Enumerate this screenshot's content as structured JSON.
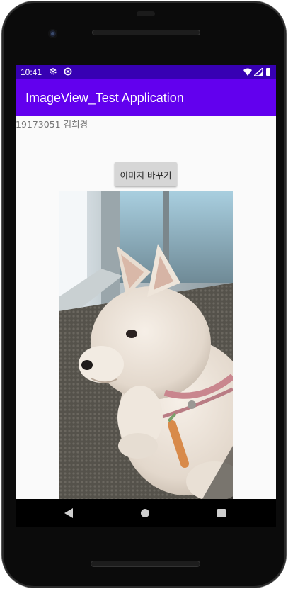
{
  "status_bar": {
    "time": "10:41",
    "icons": [
      "gear-icon",
      "sync-icon",
      "wifi-icon",
      "signal-icon",
      "battery-icon"
    ]
  },
  "app_bar": {
    "title": "ImageView_Test Application",
    "color": "#6200ee",
    "status_color": "#3700b3"
  },
  "content": {
    "student_label": "19173051 김희경",
    "button_label": "이미지 바꾸기",
    "image_icon": "puppy-photo"
  },
  "nav_bar": {
    "icons": [
      "back-icon",
      "home-icon",
      "recents-icon"
    ]
  }
}
